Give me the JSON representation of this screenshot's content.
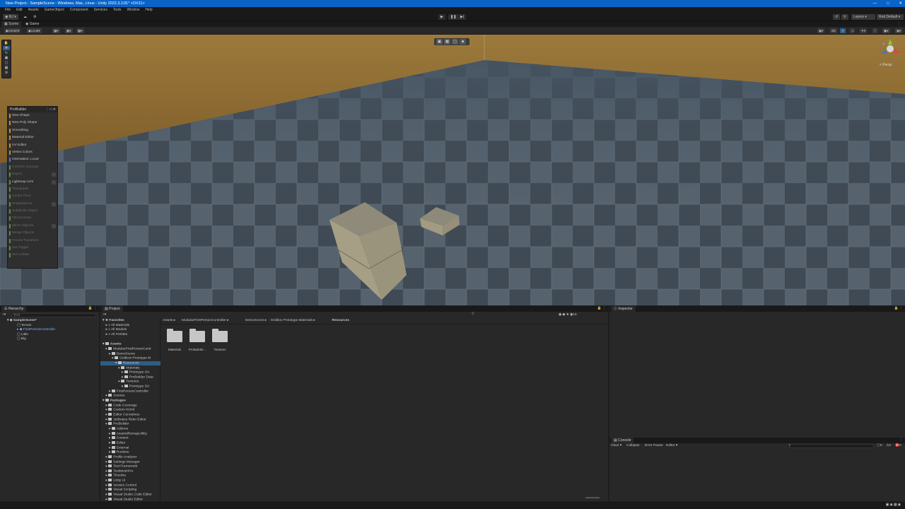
{
  "window": {
    "title": "New Project - SampleScene - Windows, Mac, Linux - Unity 2022.3.11f1* <DX11>"
  },
  "menu": [
    "File",
    "Edit",
    "Assets",
    "GameObject",
    "Component",
    "Services",
    "Tools",
    "Window",
    "Help"
  ],
  "toolbar": {
    "layers_label": "Layers",
    "layout_label": "Rod Default"
  },
  "tabs": {
    "scene": "Scene",
    "game": "Game"
  },
  "scene_bar": {
    "pivot": "Center",
    "space": "Local"
  },
  "scene": {
    "persp_label": "< Persp"
  },
  "probuilder": {
    "title": "ProBuilder",
    "items": [
      {
        "label": "New Shape",
        "color": "#c88a2a",
        "enabled": true,
        "opt": false
      },
      {
        "label": "New Poly Shape",
        "color": "#c88a2a",
        "enabled": true,
        "opt": false
      },
      {
        "label": "Smoothing",
        "color": "#c88a2a",
        "enabled": true,
        "opt": false
      },
      {
        "label": "Material Editor",
        "color": "#c88a2a",
        "enabled": true,
        "opt": false
      },
      {
        "label": "UV Editor",
        "color": "#c88a2a",
        "enabled": true,
        "opt": false
      },
      {
        "label": "Vertex Colors",
        "color": "#c88a2a",
        "enabled": true,
        "opt": false
      },
      {
        "label": "Orientation: Local",
        "color": "#3f7fcf",
        "enabled": true,
        "opt": false
      },
      {
        "label": "Conform Normals",
        "color": "#5c8f3c",
        "enabled": false,
        "opt": false
      },
      {
        "label": "Export",
        "color": "#5c8f3c",
        "enabled": false,
        "opt": true
      },
      {
        "label": "Lightmap UVs",
        "color": "#5c8f3c",
        "enabled": true,
        "opt": true
      },
      {
        "label": "Triangulate",
        "color": "#5c8f3c",
        "enabled": false,
        "opt": false
      },
      {
        "label": "Center Pivot",
        "color": "#5c8f3c",
        "enabled": false,
        "opt": false
      },
      {
        "label": "ProBuilderize",
        "color": "#5c8f3c",
        "enabled": false,
        "opt": true
      },
      {
        "label": "Subdivide Object",
        "color": "#5c8f3c",
        "enabled": false,
        "opt": false
      },
      {
        "label": "Flip Normals",
        "color": "#5c8f3c",
        "enabled": false,
        "opt": false
      },
      {
        "label": "Mirror Objects",
        "color": "#5c8f3c",
        "enabled": false,
        "opt": true
      },
      {
        "label": "Merge Objects",
        "color": "#5c8f3c",
        "enabled": false,
        "opt": false
      },
      {
        "label": "Freeze Transform",
        "color": "#5c8f3c",
        "enabled": false,
        "opt": false
      },
      {
        "label": "Set Trigger",
        "color": "#5c8f3c",
        "enabled": false,
        "opt": false
      },
      {
        "label": "Set Collider",
        "color": "#5c8f3c",
        "enabled": false,
        "opt": false
      }
    ]
  },
  "hierarchy": {
    "tab": "Hierarchy",
    "search_placeholder": "All",
    "rows": [
      {
        "label": "SampleScene*",
        "indent": 0,
        "bold": true,
        "blue": false
      },
      {
        "label": "Terrain",
        "indent": 1,
        "bold": false,
        "blue": false
      },
      {
        "label": "FirstPersonController",
        "indent": 1,
        "bold": false,
        "blue": true
      },
      {
        "label": "Little",
        "indent": 1,
        "bold": false,
        "blue": false
      },
      {
        "label": "Big",
        "indent": 1,
        "bold": false,
        "blue": false
      }
    ]
  },
  "project": {
    "tab": "Project",
    "zoom_count": "15",
    "breadcrumb": [
      "Assets",
      "ModularFirstPersonController",
      "DemoScene",
      "Gridbox Prototype Materials",
      "Resources"
    ],
    "tree": [
      {
        "label": "Favorites",
        "indent": 0,
        "folder": false,
        "bold": true
      },
      {
        "label": "All Materials",
        "indent": 1,
        "folder": false,
        "bold": false
      },
      {
        "label": "All Models",
        "indent": 1,
        "folder": false,
        "bold": false
      },
      {
        "label": "All Prefabs",
        "indent": 1,
        "folder": false,
        "bold": false
      },
      {
        "label": "",
        "indent": 0,
        "folder": false,
        "bold": false
      },
      {
        "label": "Assets",
        "indent": 0,
        "folder": true,
        "bold": true
      },
      {
        "label": "ModularFirstPersonContr",
        "indent": 1,
        "folder": true,
        "bold": false
      },
      {
        "label": "DemoScene",
        "indent": 2,
        "folder": true,
        "bold": false
      },
      {
        "label": "Gridbox Prototype M",
        "indent": 3,
        "folder": true,
        "bold": false
      },
      {
        "label": "Resources",
        "indent": 4,
        "folder": true,
        "bold": false,
        "selected": true
      },
      {
        "label": "Materials",
        "indent": 5,
        "folder": true,
        "bold": false
      },
      {
        "label": "Prototype Gri",
        "indent": 6,
        "folder": true,
        "bold": false
      },
      {
        "label": "ProBuilder Data",
        "indent": 6,
        "folder": true,
        "bold": false
      },
      {
        "label": "Textures",
        "indent": 5,
        "folder": true,
        "bold": false
      },
      {
        "label": "Prototype Gri",
        "indent": 6,
        "folder": true,
        "bold": false
      },
      {
        "label": "FirstPersonController",
        "indent": 2,
        "folder": true,
        "bold": false
      },
      {
        "label": "Scenes",
        "indent": 1,
        "folder": true,
        "bold": false
      },
      {
        "label": "Packages",
        "indent": 0,
        "folder": true,
        "bold": true
      },
      {
        "label": "Code Coverage",
        "indent": 1,
        "folder": true,
        "bold": false
      },
      {
        "label": "Custom NUnit",
        "indent": 1,
        "folder": true,
        "bold": false
      },
      {
        "label": "Editor Coroutines",
        "indent": 1,
        "folder": true,
        "bold": false
      },
      {
        "label": "JetBrains Rider Editor",
        "indent": 1,
        "folder": true,
        "bold": false
      },
      {
        "label": "ProBuilder",
        "indent": 1,
        "folder": true,
        "bold": false
      },
      {
        "label": "Addons",
        "indent": 2,
        "folder": true,
        "bold": false
      },
      {
        "label": "AssetIdRemapUtility",
        "indent": 2,
        "folder": true,
        "bold": false
      },
      {
        "label": "Content",
        "indent": 2,
        "folder": true,
        "bold": false
      },
      {
        "label": "Editor",
        "indent": 2,
        "folder": true,
        "bold": false
      },
      {
        "label": "External",
        "indent": 2,
        "folder": true,
        "bold": false
      },
      {
        "label": "Runtime",
        "indent": 2,
        "folder": true,
        "bold": false
      },
      {
        "label": "Profile Analyzer",
        "indent": 1,
        "folder": true,
        "bold": false
      },
      {
        "label": "Settings Manager",
        "indent": 1,
        "folder": true,
        "bold": false
      },
      {
        "label": "Test Framework",
        "indent": 1,
        "folder": true,
        "bold": false
      },
      {
        "label": "TextMeshPro",
        "indent": 1,
        "folder": true,
        "bold": false
      },
      {
        "label": "Timeline",
        "indent": 1,
        "folder": true,
        "bold": false
      },
      {
        "label": "Unity UI",
        "indent": 1,
        "folder": true,
        "bold": false
      },
      {
        "label": "Version Control",
        "indent": 1,
        "folder": true,
        "bold": false
      },
      {
        "label": "Visual Scripting",
        "indent": 1,
        "folder": true,
        "bold": false
      },
      {
        "label": "Visual Studio Code Editor",
        "indent": 1,
        "folder": true,
        "bold": false
      },
      {
        "label": "Visual Studio Editor",
        "indent": 1,
        "folder": true,
        "bold": false
      }
    ],
    "grid": [
      "Materials",
      "ProBuilder...",
      "Textures"
    ]
  },
  "inspector": {
    "tab": "Inspector"
  },
  "console": {
    "tab": "Console",
    "clear": "Clear",
    "collapse": "Collapse",
    "error_pause": "Error Pause",
    "editor": "Editor",
    "count0": "0",
    "count1": "0",
    "count2": "0"
  }
}
